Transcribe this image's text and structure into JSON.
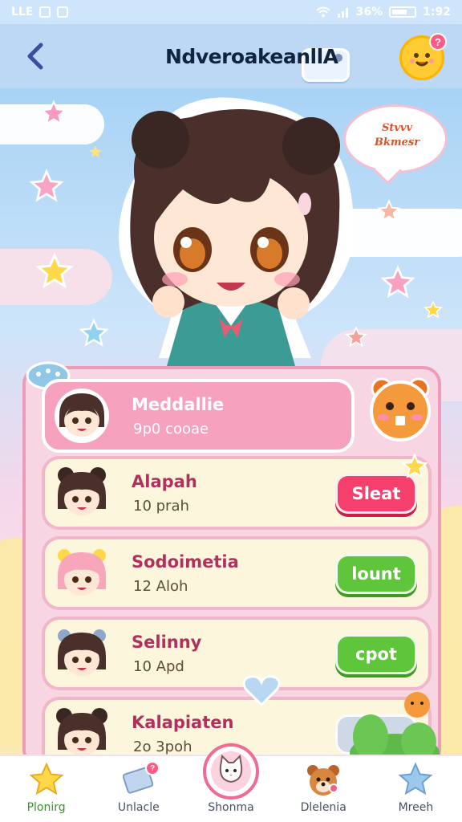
{
  "status_bar": {
    "carrier": "LLE",
    "battery_text": "36%",
    "time": "1:92"
  },
  "header": {
    "title": "NdveroakeanllA",
    "avatar_badge": "?"
  },
  "hero": {
    "speech_line1": "Stvvv",
    "speech_line2": "Bkmesr"
  },
  "list": {
    "items": [
      {
        "name": "Meddallie",
        "sub": "9p0 cooae",
        "button": "",
        "featured": true
      },
      {
        "name": "Alapah",
        "sub": "10 prah",
        "button": "Sleat",
        "color": "#f5406e"
      },
      {
        "name": "Sodoimetia",
        "sub": "12 Aloh",
        "button": "lount",
        "color": "#5fc63c"
      },
      {
        "name": "Selinny",
        "sub": "10 Apd",
        "button": "cpot",
        "color": "#5fc63c"
      },
      {
        "name": "Kalapiaten",
        "sub": "2o 3poh",
        "button": "",
        "color": "#cfd8e6"
      }
    ]
  },
  "bottom_nav": {
    "items": [
      {
        "label": "Plonirg",
        "icon": "star-icon"
      },
      {
        "label": "Unlacle",
        "icon": "card-icon",
        "badge": "?"
      },
      {
        "label": "Shonma",
        "icon": "cat-icon"
      },
      {
        "label": "Dlelenia",
        "icon": "dog-icon"
      },
      {
        "label": "Mreeh",
        "icon": "blue-star-icon"
      }
    ]
  },
  "colors": {
    "accent_pink": "#f5406e",
    "accent_green": "#5fc63c",
    "header_blue": "#bcd8f5",
    "panel_pink": "#f7d5e3"
  }
}
